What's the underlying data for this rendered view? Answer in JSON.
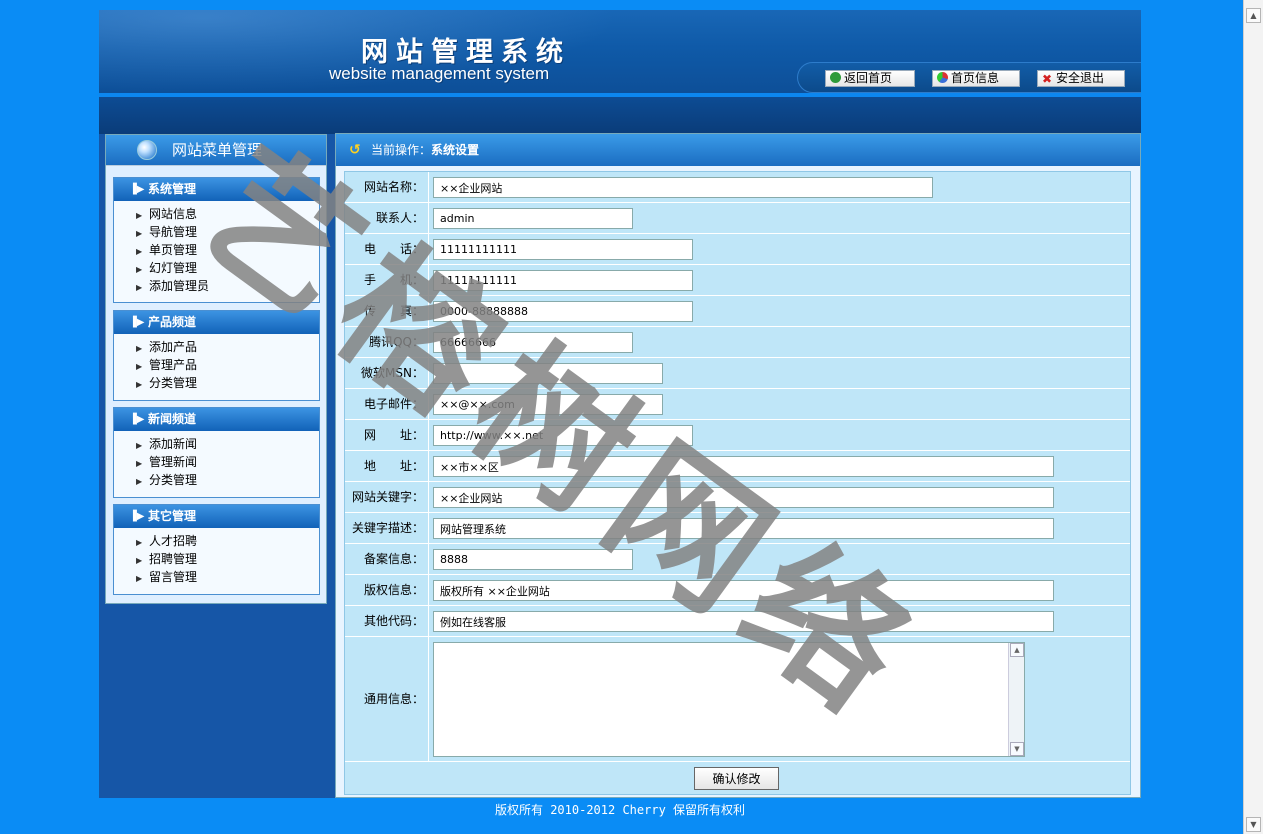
{
  "header": {
    "title_cn": "网站管理系统",
    "title_en": "website management system",
    "nav": [
      {
        "label": "返回首页",
        "icon": "home-icon"
      },
      {
        "label": "首页信息",
        "icon": "pie-chart-icon"
      },
      {
        "label": "安全退出",
        "icon": "close-icon"
      }
    ]
  },
  "sidebar": {
    "title": "网站菜单管理",
    "groups": [
      {
        "title": "系统管理",
        "items": [
          "网站信息",
          "导航管理",
          "单页管理",
          "幻灯管理",
          "添加管理员"
        ]
      },
      {
        "title": "产品频道",
        "items": [
          "添加产品",
          "管理产品",
          "分类管理"
        ]
      },
      {
        "title": "新闻频道",
        "items": [
          "添加新闻",
          "管理新闻",
          "分类管理"
        ]
      },
      {
        "title": "其它管理",
        "items": [
          "人才招聘",
          "招聘管理",
          "留言管理"
        ]
      }
    ]
  },
  "main": {
    "breadcrumb_prefix": "当前操作：",
    "breadcrumb_current": "系统设置",
    "fields": [
      {
        "label": "网站名称：",
        "value": "××企业网站"
      },
      {
        "label": "联系人：",
        "value": "admin"
      },
      {
        "label": "电　　话：",
        "value": "11111111111"
      },
      {
        "label": "手　　机：",
        "value": "11111111111"
      },
      {
        "label": "传　　真：",
        "value": "0000-88888888"
      },
      {
        "label": "腾讯QQ：",
        "value": "66666666"
      },
      {
        "label": "微软MSN：",
        "value": ""
      },
      {
        "label": "电子邮件：",
        "value": "××@××.com"
      },
      {
        "label": "网　　址：",
        "value": "http://www.××.net"
      },
      {
        "label": "地　　址：",
        "value": "××市××区"
      },
      {
        "label": "网站关键字：",
        "value": "××企业网站"
      },
      {
        "label": "关键字描述：",
        "value": "网站管理系统"
      },
      {
        "label": "备案信息：",
        "value": "8888"
      },
      {
        "label": "版权信息：",
        "value": "版权所有 ××企业网站"
      },
      {
        "label": "其他代码：",
        "value": "例如在线客服"
      }
    ],
    "textarea_label": "通用信息：",
    "textarea_value": "",
    "submit_label": "确认修改"
  },
  "footer": {
    "text": "版权所有 2010-2012 Cherry 保留所有权利"
  },
  "watermark": {
    "text": "艺榕树网络"
  },
  "colors": {
    "page_bg": "#0a8cf5",
    "header_bg": "#0f5aa8",
    "form_bg": "#bfe6f8",
    "accent": "#1b6dc1"
  }
}
